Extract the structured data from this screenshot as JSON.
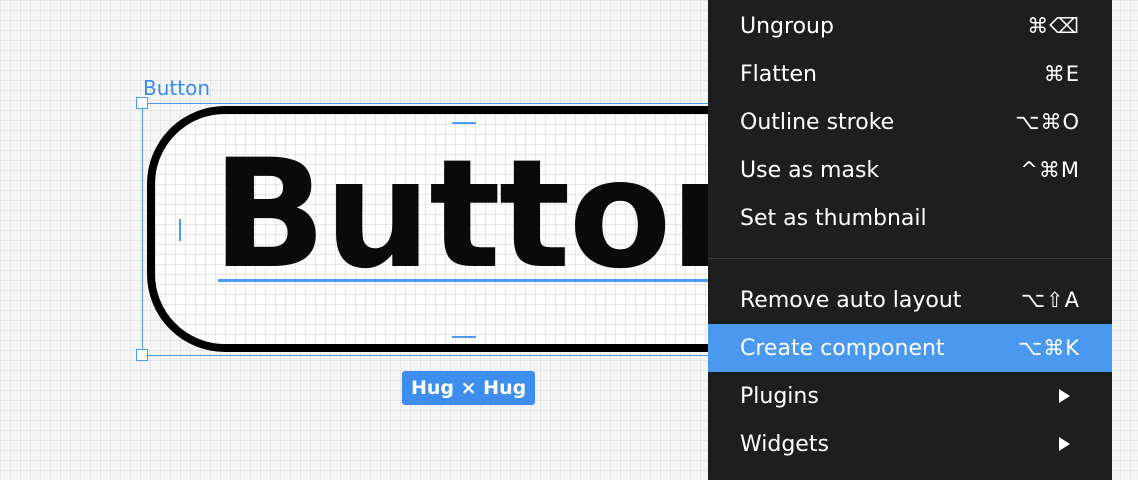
{
  "canvas": {
    "frame_label": "Button",
    "button_text": "Button",
    "size_badge": "Hug × Hug"
  },
  "menu": {
    "items": [
      {
        "label": "Ungroup",
        "shortcut": "⌘⌫"
      },
      {
        "label": "Flatten",
        "shortcut": "⌘E"
      },
      {
        "label": "Outline stroke",
        "shortcut": "⌥⌘O"
      },
      {
        "label": "Use as mask",
        "shortcut": "^⌘M"
      },
      {
        "label": "Set as thumbnail",
        "shortcut": ""
      },
      {
        "label": "Remove auto layout",
        "shortcut": "⌥⇧A"
      },
      {
        "label": "Create component",
        "shortcut": "⌥⌘K",
        "highlighted": true
      },
      {
        "label": "Plugins",
        "submenu": true
      },
      {
        "label": "Widgets",
        "submenu": true
      }
    ]
  },
  "colors": {
    "selection": "#4a9cf0",
    "menu_background": "#1e1e1e",
    "menu_highlight": "#4a99ee",
    "badge": "#3d8eef"
  }
}
